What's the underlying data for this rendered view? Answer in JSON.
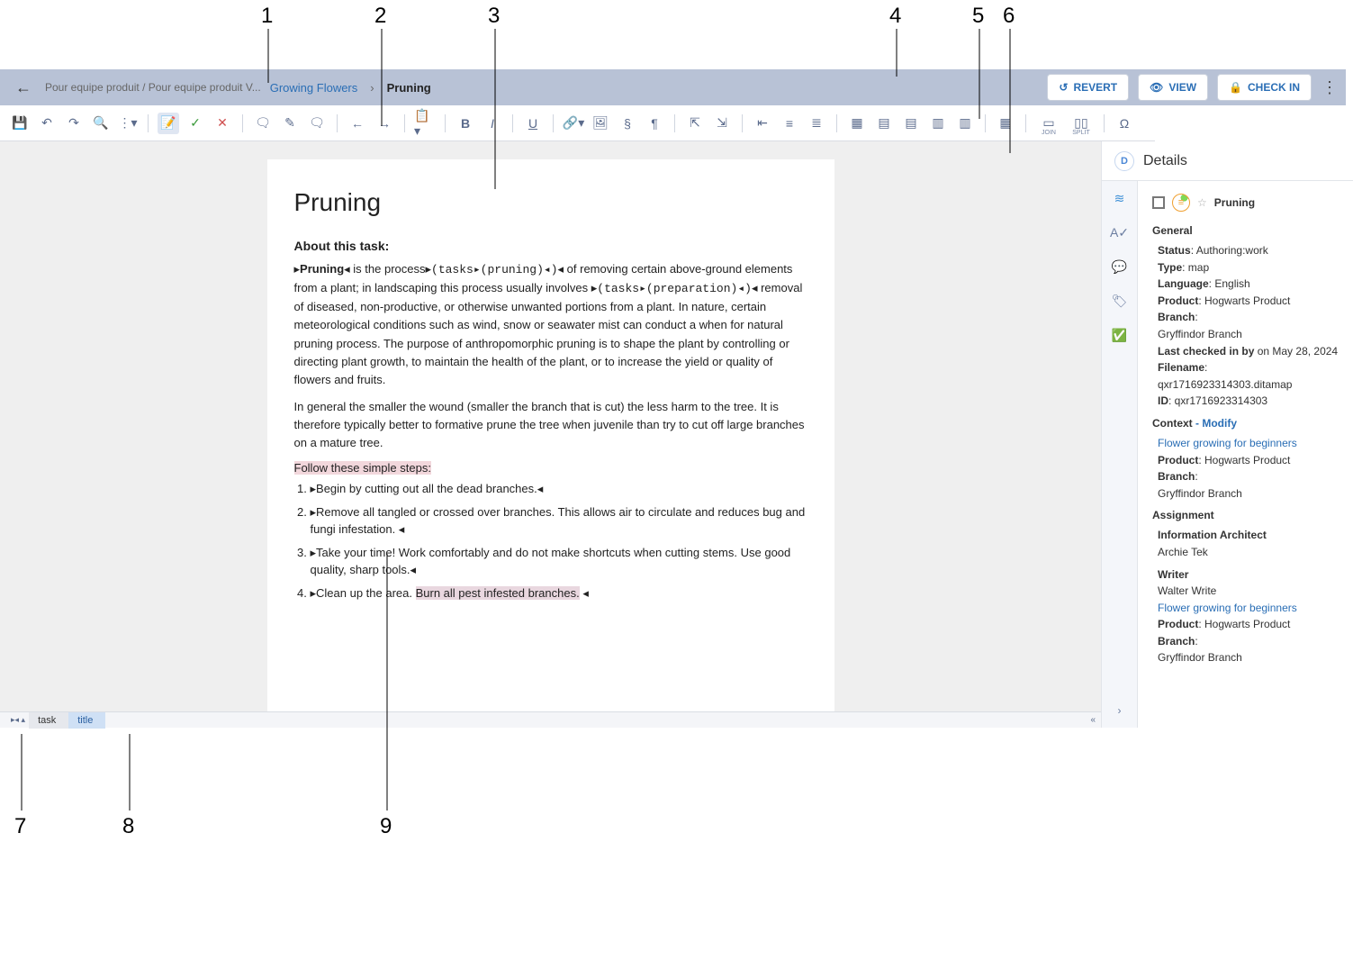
{
  "annotations": [
    "1",
    "2",
    "3",
    "4",
    "5",
    "6",
    "7",
    "8",
    "9"
  ],
  "breadcrumb": {
    "gray": "Pour equipe produit / Pour equipe produit V...",
    "link": "Growing Flowers",
    "current": "Pruning"
  },
  "top_buttons": {
    "revert": "REVERT",
    "view": "VIEW",
    "checkin": "CHECK IN"
  },
  "doc": {
    "title": "Pruning",
    "about_head": "About this task:",
    "p1_a": "Pruning",
    "p1_b": " is the process",
    "p1_code1": "(tasks▸(pruning)◂)",
    "p1_c": " of removing certain above-ground elements from a plant; in landscaping this process usually involves ",
    "p1_code2": "(tasks▸(preparation)◂)",
    "p1_d": " removal of diseased, non-productive, or otherwise unwanted portions from a plant. In nature, certain meteorological conditions such as wind, snow or seawater mist can conduct a when for natural pruning process. The purpose of anthropomorphic pruning is to shape the plant by controlling or directing plant growth, to maintain the health of the plant, or to increase the yield or quality of flowers and fruits.",
    "p2": "In general the smaller the wound (smaller the branch that is cut) the less harm to the tree. It is therefore typically better to formative prune the tree when juvenile than try to cut off large branches on a mature tree.",
    "steps_head": "Follow these simple steps:",
    "steps": [
      "Begin by cutting out all the dead branches.",
      "Remove all tangled or crossed over branches. This allows air to circulate and reduces bug and fungi infestation. ",
      "Take your time! Work comfortably and do not make shortcuts when cutting stems. Use good quality, sharp tools.",
      "Clean up the area. "
    ],
    "step4_mark": "Burn all pest infested branches."
  },
  "bc_bar": {
    "seg1": "task",
    "seg2": "title"
  },
  "side": {
    "title": "Details",
    "obj_title": "Pruning",
    "general_head": "General",
    "status_k": "Status",
    "status_v": ": Authoring:work",
    "type_k": "Type",
    "type_v": ": map",
    "lang_k": "Language",
    "lang_v": ": English",
    "product_k": "Product",
    "product_v": ": Hogwarts Product",
    "branch_k": "Branch",
    "branch_v": ":",
    "branch_line": "Gryffindor Branch",
    "checked_k": "Last checked in by",
    "checked_v": "  on May 28, 2024",
    "file_k": "Filename",
    "file_v": ": qxr1716923314303.ditamap",
    "id_k": "ID",
    "id_v": ": qxr1716923314303",
    "context_head": "Context",
    "context_link": "  - Modify",
    "ctx_link1": "Flower growing for beginners",
    "ctx_prod_k": "Product",
    "ctx_prod_v": ": Hogwarts Product",
    "ctx_branch_k": "Branch",
    "ctx_branch_v": ":",
    "ctx_branch_line": "Gryffindor Branch",
    "assign_head": "Assignment",
    "role1": "Information Architect",
    "role1_name": "Archie Tek",
    "role2": "Writer",
    "role2_name": "Walter Write",
    "assign_link": "Flower growing for beginners",
    "assign_prod_k": "Product",
    "assign_prod_v": ": Hogwarts Product",
    "assign_branch_k": "Branch",
    "assign_branch_v": ":",
    "assign_branch_line": "Gryffindor Branch"
  },
  "toolbar_labels": {
    "join": "JOIN",
    "split": "SPLIT"
  }
}
